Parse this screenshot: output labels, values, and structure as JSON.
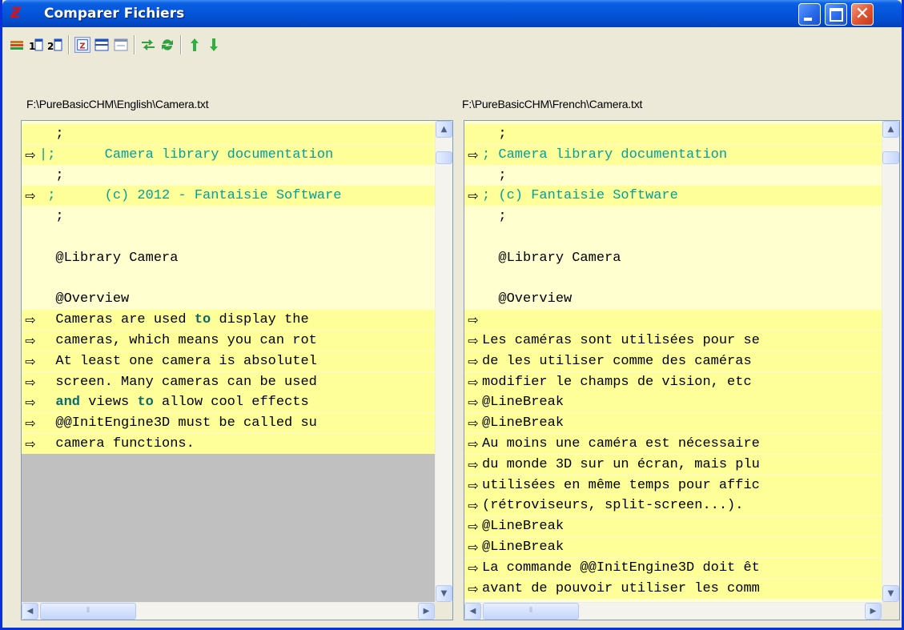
{
  "window": {
    "title": "Comparer Fichiers",
    "controls": {
      "minimize": "_",
      "maximize": "□",
      "close": "✕"
    }
  },
  "toolbar": {
    "icons": [
      "open-files-icon",
      "file1-icon",
      "file2-icon",
      "view-side-by-side-icon",
      "view-horizontal-icon",
      "view-single-icon",
      "swap-files-icon",
      "refresh-icon",
      "prev-diff-icon",
      "next-diff-icon"
    ]
  },
  "left_pane": {
    "path": "F:\\PureBasicCHM\\English\\Camera.txt",
    "lines": [
      {
        "marker": "",
        "text": "  ;",
        "hl": true
      },
      {
        "marker": "⇨",
        "text": "|;      Camera library documentation",
        "hl": true,
        "cyan": true
      },
      {
        "marker": "",
        "text": "  ;",
        "hl": false
      },
      {
        "marker": "⇨",
        "text": " ;      (c) 2012 - Fantaisie Software",
        "hl": true,
        "cyan": true
      },
      {
        "marker": "",
        "text": "  ;",
        "hl": false
      },
      {
        "marker": "",
        "text": "",
        "hl": false
      },
      {
        "marker": "",
        "text": "  @Library Camera",
        "hl": false
      },
      {
        "marker": "",
        "text": "",
        "hl": false
      },
      {
        "marker": "",
        "text": "  @Overview",
        "hl": false
      },
      {
        "marker": "⇨",
        "text": "  Cameras are used to display the",
        "hl": true
      },
      {
        "marker": "⇨",
        "text": "  cameras, which means you can rot",
        "hl": true
      },
      {
        "marker": "⇨",
        "text": "  At least one camera is absolutel",
        "hl": true
      },
      {
        "marker": "⇨",
        "text": "  screen. Many cameras can be used",
        "hl": true
      },
      {
        "marker": "⇨",
        "text": "  and views to allow cool effects",
        "hl": true
      },
      {
        "marker": "⇨",
        "text": "  @@InitEngine3D must be called su",
        "hl": true
      },
      {
        "marker": "⇨",
        "text": "  camera functions.",
        "hl": true
      }
    ]
  },
  "right_pane": {
    "path": "F:\\PureBasicCHM\\French\\Camera.txt",
    "lines": [
      {
        "marker": "",
        "text": "  ;",
        "hl": true
      },
      {
        "marker": "⇨",
        "text": "; Camera library documentation",
        "hl": true,
        "cyan": true
      },
      {
        "marker": "",
        "text": "  ;",
        "hl": false
      },
      {
        "marker": "⇨",
        "text": "; (c) Fantaisie Software",
        "hl": true,
        "cyan": true
      },
      {
        "marker": "",
        "text": "  ;",
        "hl": false
      },
      {
        "marker": "",
        "text": "",
        "hl": false
      },
      {
        "marker": "",
        "text": "  @Library Camera",
        "hl": false
      },
      {
        "marker": "",
        "text": "",
        "hl": false
      },
      {
        "marker": "",
        "text": "  @Overview",
        "hl": false
      },
      {
        "marker": "⇨",
        "text": "",
        "hl": true
      },
      {
        "marker": "⇨",
        "text": "Les caméras sont utilisées pour se",
        "hl": true
      },
      {
        "marker": "⇨",
        "text": "de les utiliser comme des caméras",
        "hl": true
      },
      {
        "marker": "⇨",
        "text": "modifier le champs de vision, etc",
        "hl": true
      },
      {
        "marker": "⇨",
        "text": "@LineBreak",
        "hl": true
      },
      {
        "marker": "⇨",
        "text": "@LineBreak",
        "hl": true
      },
      {
        "marker": "⇨",
        "text": "Au moins une caméra est nécessaire",
        "hl": true
      },
      {
        "marker": "⇨",
        "text": "du monde 3D sur un écran, mais plu",
        "hl": true
      },
      {
        "marker": "⇨",
        "text": "utilisées en même temps pour affic",
        "hl": true
      },
      {
        "marker": "⇨",
        "text": "(rétroviseurs, split-screen...).",
        "hl": true
      },
      {
        "marker": "⇨",
        "text": "@LineBreak",
        "hl": true
      },
      {
        "marker": "⇨",
        "text": "@LineBreak",
        "hl": true
      },
      {
        "marker": "⇨",
        "text": "La commande @@InitEngine3D doit êt",
        "hl": true
      },
      {
        "marker": "⇨",
        "text": "avant de pouvoir utiliser les comm",
        "hl": true
      }
    ]
  },
  "scrollbars": {
    "up": "▲",
    "down": "▼",
    "left": "◀",
    "right": "▶",
    "grip": "⦀"
  },
  "colors": {
    "diff_highlight": "#ffff99",
    "base_bg": "#ffffd0",
    "comment": "#00a0a0",
    "keyword": "#0a6a6a",
    "titlebar": "#0454d9"
  }
}
